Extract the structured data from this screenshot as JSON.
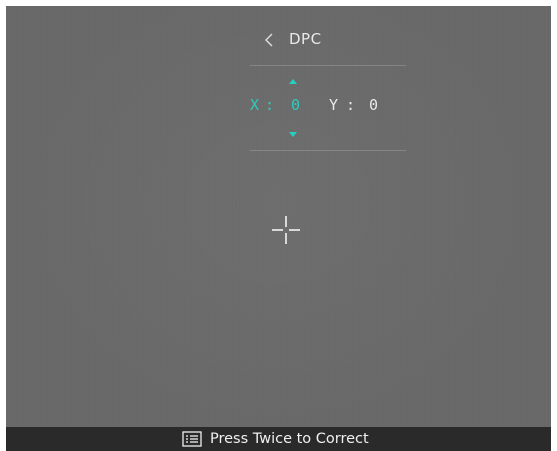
{
  "header": {
    "back_icon": "chevron-left-icon",
    "title": "DPC"
  },
  "coordinates": {
    "x_label": "X",
    "x_separator": ":",
    "x_value": "0",
    "y_label": "Y",
    "y_separator": ":",
    "y_value": "0",
    "selected_axis": "X",
    "up_icon": "arrow-up-icon",
    "down_icon": "arrow-down-icon"
  },
  "crosshair": {
    "icon": "crosshair-icon"
  },
  "footer": {
    "icon": "menu-icon",
    "hint": "Press Twice to Correct"
  },
  "colors": {
    "accent": "#25d0c0",
    "screen_background": "#686868",
    "text": "#e9e9e9",
    "footer_background": "#2a2a2a"
  }
}
